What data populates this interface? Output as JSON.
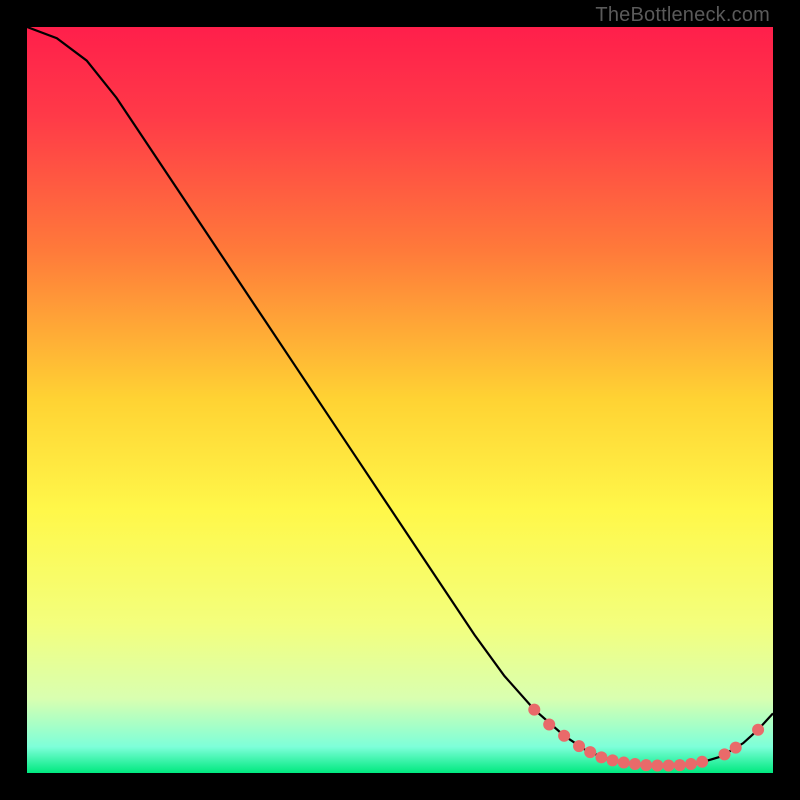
{
  "watermark": "TheBottleneck.com",
  "chart_data": {
    "type": "line",
    "title": "",
    "xlabel": "",
    "ylabel": "",
    "xlim": [
      0,
      100
    ],
    "ylim": [
      0,
      100
    ],
    "gradient_stops": [
      {
        "offset": 0.0,
        "color": "#ff1f4b"
      },
      {
        "offset": 0.12,
        "color": "#ff3a48"
      },
      {
        "offset": 0.3,
        "color": "#ff7a3a"
      },
      {
        "offset": 0.5,
        "color": "#ffd333"
      },
      {
        "offset": 0.65,
        "color": "#fff84a"
      },
      {
        "offset": 0.8,
        "color": "#f3ff7d"
      },
      {
        "offset": 0.9,
        "color": "#d9ffb0"
      },
      {
        "offset": 0.965,
        "color": "#7dffd9"
      },
      {
        "offset": 1.0,
        "color": "#00e97f"
      }
    ],
    "series": [
      {
        "name": "curve",
        "stroke": "#000000",
        "x": [
          0,
          4,
          8,
          12,
          16,
          20,
          24,
          28,
          32,
          36,
          40,
          44,
          48,
          52,
          56,
          60,
          64,
          68,
          72,
          75,
          78,
          81,
          84,
          87,
          90,
          93,
          96,
          98,
          100
        ],
        "y": [
          100,
          98.5,
          95.5,
          90.5,
          84.5,
          78.5,
          72.5,
          66.5,
          60.5,
          54.5,
          48.5,
          42.5,
          36.5,
          30.5,
          24.5,
          18.5,
          13,
          8.5,
          5,
          3,
          1.8,
          1.2,
          1,
          1,
          1.3,
          2.2,
          4,
          5.8,
          8
        ]
      }
    ],
    "markers": {
      "color": "#e96a6a",
      "radius": 6,
      "points": [
        {
          "x": 68,
          "y": 8.5
        },
        {
          "x": 70,
          "y": 6.5
        },
        {
          "x": 72,
          "y": 5
        },
        {
          "x": 74,
          "y": 3.6
        },
        {
          "x": 75.5,
          "y": 2.8
        },
        {
          "x": 77,
          "y": 2.1
        },
        {
          "x": 78.5,
          "y": 1.7
        },
        {
          "x": 80,
          "y": 1.4
        },
        {
          "x": 81.5,
          "y": 1.2
        },
        {
          "x": 83,
          "y": 1.05
        },
        {
          "x": 84.5,
          "y": 1
        },
        {
          "x": 86,
          "y": 1
        },
        {
          "x": 87.5,
          "y": 1.05
        },
        {
          "x": 89,
          "y": 1.2
        },
        {
          "x": 90.5,
          "y": 1.5
        },
        {
          "x": 93.5,
          "y": 2.5
        },
        {
          "x": 95,
          "y": 3.4
        },
        {
          "x": 98,
          "y": 5.8
        }
      ]
    }
  }
}
